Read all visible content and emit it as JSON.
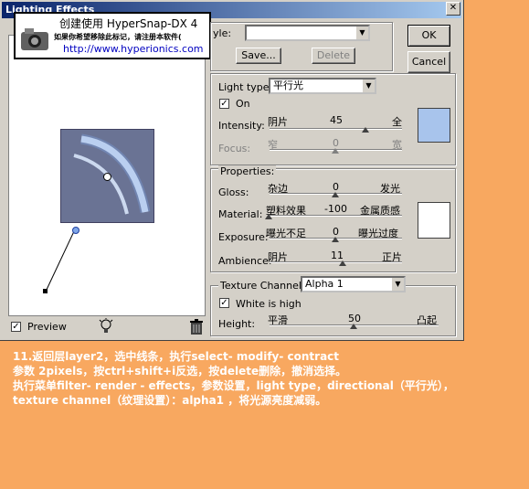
{
  "dialog": {
    "title": "Lighting Effects",
    "close_glyph": "✕",
    "style_label": "yle:",
    "style_value": "",
    "ok_label": "OK",
    "cancel_label": "Cancel",
    "save_label": "Save...",
    "delete_label": "Delete"
  },
  "light": {
    "type_label": "Light type:",
    "type_value": "平行光",
    "on_label": "On",
    "on_checked": true,
    "intensity": {
      "label": "Intensity:",
      "left": "阴片",
      "value": "45",
      "right": "全",
      "fraction": 0.68
    },
    "focus": {
      "label": "Focus:",
      "left": "窄",
      "value": "0",
      "right": "宽",
      "fraction": 0.5
    },
    "color": "#A8C4EC"
  },
  "properties": {
    "title": "Properties:",
    "gloss": {
      "label": "Gloss:",
      "left": "杂边",
      "value": "0",
      "right": "发光",
      "fraction": 0.5
    },
    "material": {
      "label": "Material:",
      "left": "塑料效果",
      "value": "-100",
      "right": "金属质感",
      "fraction": 0.0
    },
    "exposure": {
      "label": "Exposure:",
      "left": "曝光不足",
      "value": "0",
      "right": "曝光过度",
      "fraction": 0.5
    },
    "ambience": {
      "label": "Ambience:",
      "left": "阴片",
      "value": "11",
      "right": "正片",
      "fraction": 0.55
    },
    "color": "#FFFFFF"
  },
  "texture": {
    "channel_label": "Texture Channel:",
    "channel_value": "Alpha 1",
    "white_high_label": "White is high",
    "white_high_checked": true,
    "height": {
      "label": "Height:",
      "left": "平滑",
      "value": "50",
      "right": "凸起",
      "fraction": 0.5
    }
  },
  "preview": {
    "label": "Preview",
    "checked": true,
    "icons": [
      "light-bulb-icon",
      "trash-icon"
    ]
  },
  "watermark": {
    "line1": "创建使用 HyperSnap-DX 4",
    "line2": "如果你希望移除此标记，请注册本软件(",
    "line3": "http://www.hyperionics.com"
  },
  "caption": {
    "line1": "11.返回层layer2，选中线条，执行select- modify- contract",
    "line2": "参数 2pixels，按ctrl+shift+i反选，按delete删除，撤消选择。",
    "line3": "执行菜单filter- render - effects，参数设置，light type，directional（平行光），",
    "line4": "texture  channel（纹理设置）：alpha1 ，将光源亮度减弱。"
  },
  "colors": {
    "background": "#F8A860",
    "dialog": "#D4D0C8",
    "preview_image": "#6A7394"
  }
}
